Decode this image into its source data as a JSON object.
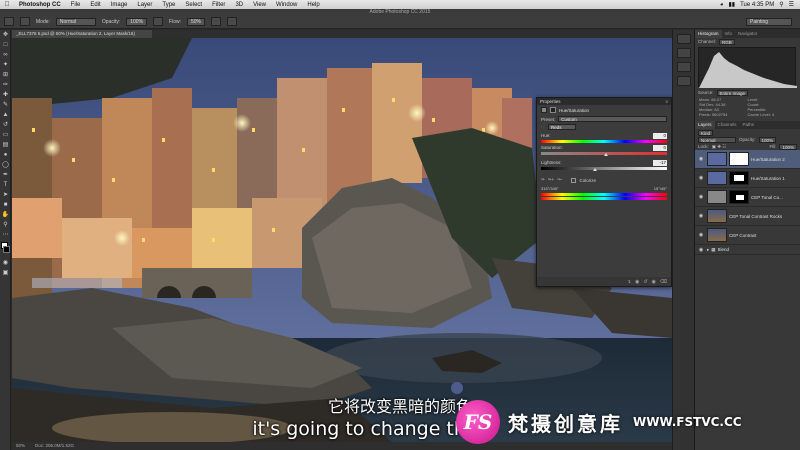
{
  "menubar": {
    "app_name": "Photoshop CC",
    "items": [
      "File",
      "Edit",
      "Image",
      "Layer",
      "Type",
      "Select",
      "Filter",
      "3D",
      "View",
      "Window",
      "Help"
    ],
    "clock": "Tue 4:35 PM"
  },
  "window_title": "Adobe Photoshop CC 2015",
  "options": {
    "mode_label": "Mode:",
    "mode_value": "Normal",
    "opacity_label": "Opacity:",
    "opacity_value": "100%",
    "flow_label": "Flow:",
    "flow_value": "50%",
    "workspace": "Painting"
  },
  "document": {
    "tab": "_ELL7376 5.psd @ 50% (Hue/Saturation 2, Layer Mask/16)",
    "zoom": "50%",
    "doc_size": "Doc: 206.0M/1.52G"
  },
  "histogram": {
    "tabs": [
      "Histogram",
      "Info",
      "Navigator"
    ],
    "channel_label": "Channel:",
    "channel_value": "RGB",
    "source_label": "Source:",
    "source_value": "Entire Image",
    "stats": [
      [
        "Mean:",
        "86.07"
      ],
      [
        "Level:",
        ""
      ],
      [
        "Std Dev:",
        "44.38"
      ],
      [
        "Count:",
        ""
      ],
      [
        "Median:",
        "83"
      ],
      [
        "Percentile:",
        ""
      ],
      [
        "Pixels:",
        "5602754"
      ],
      [
        "Cache Level:",
        "4"
      ]
    ]
  },
  "layers": {
    "tabs": [
      "Layers",
      "Channels",
      "Paths"
    ],
    "kind": "Kind",
    "blend": "Normal",
    "opacity_label": "Opacity:",
    "opacity_value": "100%",
    "lock_label": "Lock:",
    "fill_label": "Fill:",
    "fill_value": "100%",
    "items": [
      {
        "name": "Hue/Saturation 2",
        "selected": true
      },
      {
        "name": "Hue/Saturation 1",
        "selected": false
      },
      {
        "name": "CEP Tonal Co...",
        "selected": false
      },
      {
        "name": "CEP Tonal Contrast Rocks",
        "selected": false
      },
      {
        "name": "CEP Contrast",
        "selected": false
      },
      {
        "name": "Blend",
        "selected": false
      }
    ]
  },
  "properties": {
    "header": "Properties",
    "title": "Hue/Saturation",
    "preset_label": "Preset:",
    "preset_value": "Custom",
    "channel_value": "Reds",
    "hue_label": "Hue:",
    "hue_value": "0",
    "saturation_label": "Saturation:",
    "saturation_value": "0",
    "lightness_label": "Lightness:",
    "lightness_value": "-17",
    "lightness_fraction": 0.415,
    "colorize_label": "Colorize",
    "range_left": "315°/345°",
    "range_right": "15°\\45°"
  },
  "subtitle": {
    "chinese": "它将改变黑暗的颜色",
    "english": "it's going to change the"
  },
  "watermark": {
    "logo": "FS",
    "name": "梵摄创意库",
    "url": "WWW.FSTVC.CC"
  }
}
